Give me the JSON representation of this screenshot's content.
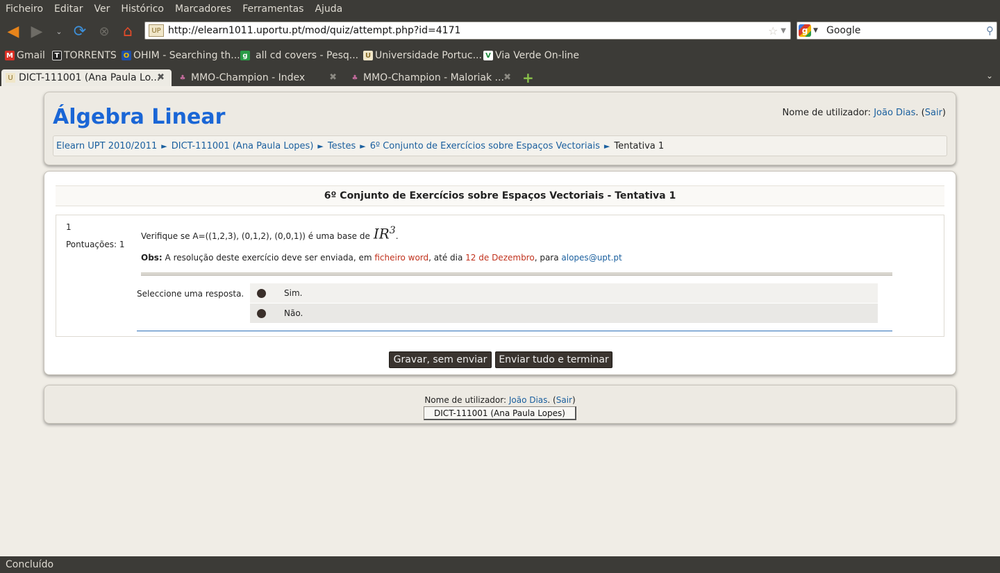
{
  "menu": [
    "Ficheiro",
    "Editar",
    "Ver",
    "Histórico",
    "Marcadores",
    "Ferramentas",
    "Ajuda"
  ],
  "navbar": {
    "url": "http://elearn1011.uportu.pt/mod/quiz/attempt.php?id=4171",
    "search_placeholder": "Google"
  },
  "bookmarks": [
    "Gmail",
    "TORRENTS",
    "OHIM - Searching th...",
    "all cd covers - Pesq...",
    "Universidade Portuc...",
    "Via Verde On-line"
  ],
  "tabs": [
    "DICT-111001 (Ana Paula Lo...",
    "MMO-Champion - Index",
    "MMO-Champion - Maloriak ..."
  ],
  "page": {
    "site_title": "Álgebra Linear",
    "login_prefix": "Nome de utilizador: ",
    "user_name": "João Dias",
    "logout": "Sair",
    "breadcrumb": [
      "Elearn UPT 2010/2011",
      "DICT-111001 (Ana Paula Lopes)",
      "Testes",
      "6º Conjunto de Exercícios sobre Espaços Vectoriais"
    ],
    "breadcrumb_current": "Tentativa 1",
    "quiz_title": "6º Conjunto de Exercícios sobre Espaços Vectoriais - Tentativa 1"
  },
  "question": {
    "number": "1",
    "score": "Pontuações: 1",
    "text": "Verifique se A=((1,2,3), (0,1,2), (0,0,1)) é uma base de",
    "math": "IR",
    "math_sup": "3",
    "obs_label": "Obs:",
    "obs_text1": " A resolução deste exercício deve ser enviada, em ",
    "obs_highlight1": "ficheiro word",
    "obs_text2": ", até dia ",
    "obs_highlight2": "12 de Dezembro",
    "obs_text3": ", para ",
    "obs_email": "alopes@upt.pt",
    "prompt": "Seleccione uma resposta.",
    "answers": [
      "Sim.",
      "Não."
    ]
  },
  "buttons": {
    "save": "Gravar, sem enviar",
    "submit": "Enviar tudo e terminar"
  },
  "footer": {
    "course_button": "DICT-111001 (Ana Paula Lopes)"
  },
  "status": "Concluído"
}
